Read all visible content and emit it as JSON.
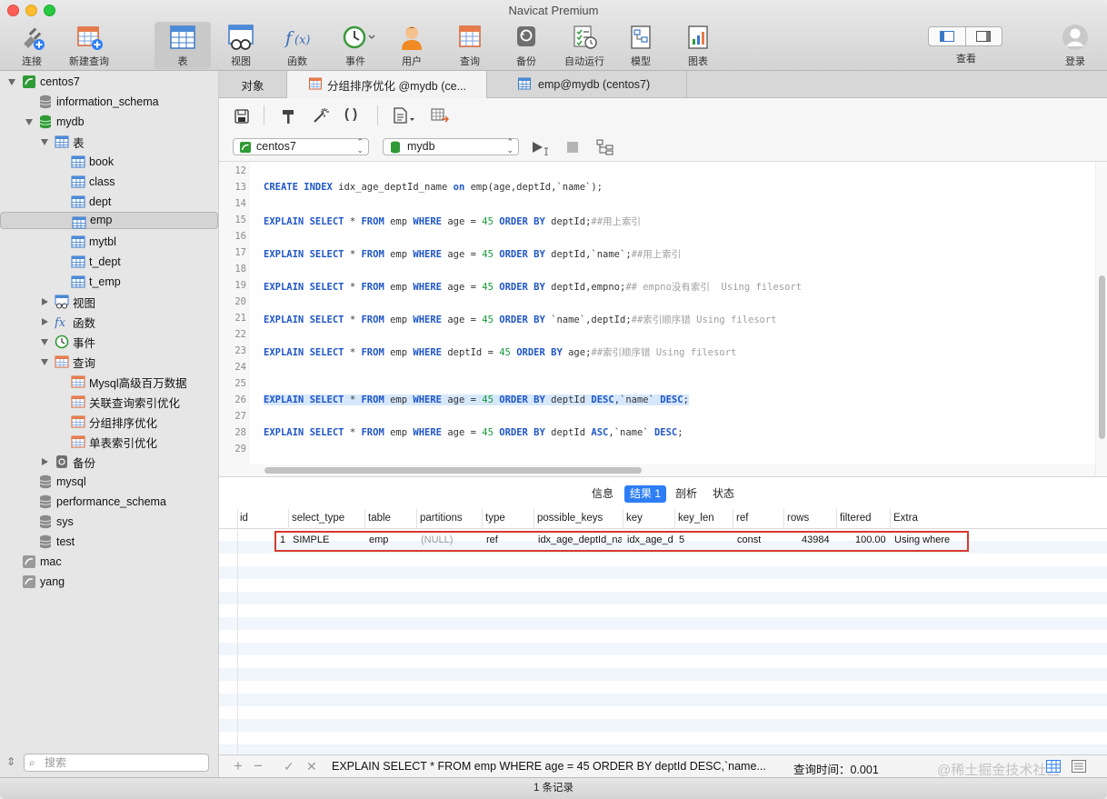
{
  "window": {
    "title": "Navicat Premium"
  },
  "toolbar": {
    "connect": "连接",
    "new_query": "新建查询",
    "table": "表",
    "view": "视图",
    "function": "函数",
    "event": "事件",
    "user": "用户",
    "query": "查询",
    "backup": "备份",
    "automation": "自动运行",
    "model": "模型",
    "chart": "图表",
    "view_toggle": "查看",
    "login": "登录"
  },
  "sidebar": {
    "connection": "centos7",
    "databases": [
      "information_schema",
      "mydb"
    ],
    "tables_label": "表",
    "tables": [
      "book",
      "class",
      "dept",
      "emp",
      "mytbl",
      "t_dept",
      "t_emp"
    ],
    "views_label": "视图",
    "functions_label": "函数",
    "events_label": "事件",
    "queries_label": "查询",
    "queries": [
      "Mysql高级百万数据",
      "关联查询索引优化",
      "分组排序优化",
      "单表索引优化"
    ],
    "backup_label": "备份",
    "other_databases": [
      "mysql",
      "performance_schema",
      "sys",
      "test"
    ],
    "other_connections": [
      "mac",
      "yang"
    ],
    "search_placeholder": "搜索"
  },
  "tabs": {
    "objects": "对象",
    "tab1": "分组排序优化 @mydb (ce...",
    "tab2": "emp@mydb (centos7)"
  },
  "selectors": {
    "connection": "centos7",
    "database": "mydb"
  },
  "editor": {
    "line_numbers": [
      "12",
      "13",
      "14",
      "15",
      "16",
      "17",
      "18",
      "19",
      "20",
      "21",
      "22",
      "23",
      "24",
      "25",
      "26",
      "27",
      "28",
      "29"
    ],
    "highlighted_line": "26"
  },
  "results": {
    "tabs": {
      "info": "信息",
      "result1": "结果 1",
      "profile": "剖析",
      "status": "状态"
    },
    "columns": [
      "id",
      "select_type",
      "table",
      "partitions",
      "type",
      "possible_keys",
      "key",
      "key_len",
      "ref",
      "rows",
      "filtered",
      "Extra"
    ],
    "row": {
      "id": "1",
      "select_type": "SIMPLE",
      "table": "emp",
      "partitions": "(NULL)",
      "type": "ref",
      "possible_keys": "idx_age_deptId_na",
      "key": "idx_age_d",
      "key_len": "5",
      "ref": "const",
      "rows": "43984",
      "filtered": "100.00",
      "extra": "Using where"
    }
  },
  "bottom": {
    "sql": "EXPLAIN SELECT * FROM emp WHERE age = 45 ORDER BY deptId DESC,`name...",
    "query_time": "查询时间：0.001",
    "watermark": "@稀土掘金技术社区"
  },
  "status": {
    "records": "1 条记录"
  },
  "colors": {
    "keyword": "#1f56c7",
    "number": "#159a3b",
    "comment": "#a0a0a0",
    "accent": "#2d7ef5",
    "highlight_box": "#d63a2b"
  }
}
